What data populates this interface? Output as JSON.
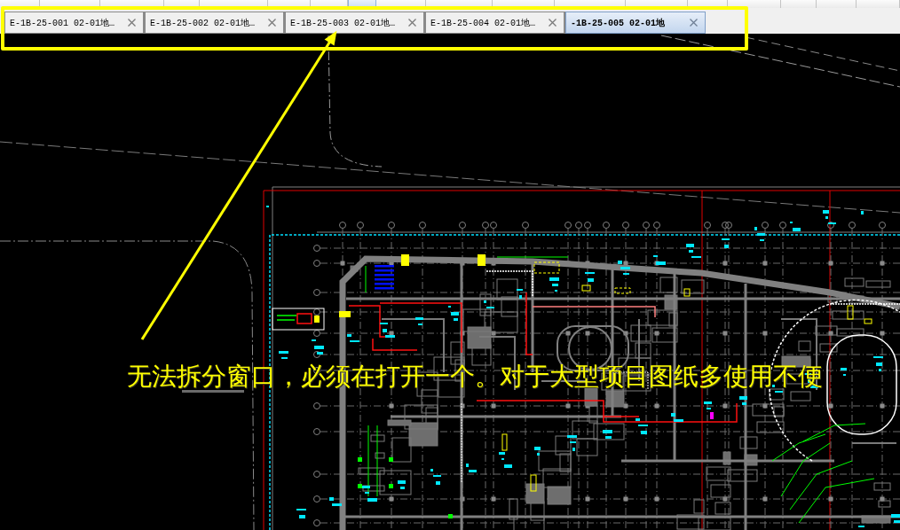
{
  "toolbar": {
    "buttons": [
      {
        "selected": false
      },
      {
        "selected": false
      },
      {
        "selected": false
      },
      {
        "selected": false
      },
      {
        "selected": false
      },
      {
        "selected": false
      },
      {
        "selected": false
      },
      {
        "selected": true
      },
      {
        "selected": false
      },
      {
        "selected": false
      },
      {
        "selected": false
      },
      {
        "selected": false
      },
      {
        "selected": false
      },
      {
        "selected": false
      },
      {
        "selected": false
      },
      {
        "selected": false
      },
      {
        "selected": false
      },
      {
        "selected": false
      }
    ]
  },
  "tabs": [
    {
      "label": "E-1B-25-001 02-01地…",
      "selected": false
    },
    {
      "label": "E-1B-25-002 02-01地…",
      "selected": false
    },
    {
      "label": "E-1B-25-003 02-01地…",
      "selected": false
    },
    {
      "label": "E-1B-25-004 02-01地…",
      "selected": false
    },
    {
      "label": "-1B-25-005 02-01地",
      "selected": true
    }
  ],
  "annotation": {
    "text": "无法拆分窗口，必须在打开一个。对于大型项目图纸多使用不便"
  }
}
